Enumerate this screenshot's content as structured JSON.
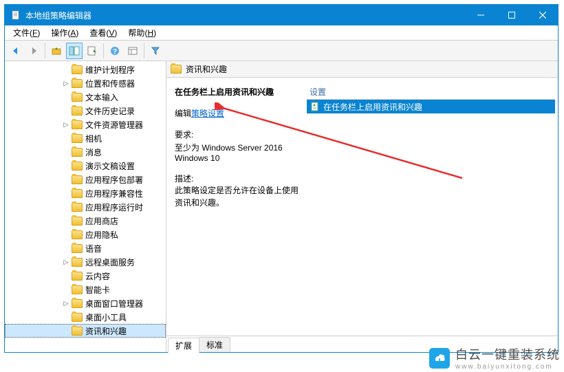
{
  "window": {
    "title": "本地组策略编辑器"
  },
  "menubar": [
    {
      "label": "文件",
      "hotkey": "F"
    },
    {
      "label": "操作",
      "hotkey": "A"
    },
    {
      "label": "查看",
      "hotkey": "V"
    },
    {
      "label": "帮助",
      "hotkey": "H"
    }
  ],
  "tree": {
    "items": [
      {
        "label": "维护计划程序",
        "expandable": false,
        "level": 1
      },
      {
        "label": "位置和传感器",
        "expandable": true,
        "level": 1
      },
      {
        "label": "文本输入",
        "expandable": false,
        "level": 1
      },
      {
        "label": "文件历史记录",
        "expandable": false,
        "level": 1
      },
      {
        "label": "文件资源管理器",
        "expandable": true,
        "level": 1
      },
      {
        "label": "相机",
        "expandable": false,
        "level": 1
      },
      {
        "label": "消息",
        "expandable": false,
        "level": 1
      },
      {
        "label": "演示文稿设置",
        "expandable": false,
        "level": 1
      },
      {
        "label": "应用程序包部署",
        "expandable": false,
        "level": 1
      },
      {
        "label": "应用程序兼容性",
        "expandable": false,
        "level": 1
      },
      {
        "label": "应用程序运行时",
        "expandable": false,
        "level": 1
      },
      {
        "label": "应用商店",
        "expandable": false,
        "level": 1
      },
      {
        "label": "应用隐私",
        "expandable": false,
        "level": 1
      },
      {
        "label": "语音",
        "expandable": false,
        "level": 1
      },
      {
        "label": "远程桌面服务",
        "expandable": true,
        "level": 1
      },
      {
        "label": "云内容",
        "expandable": false,
        "level": 1
      },
      {
        "label": "智能卡",
        "expandable": false,
        "level": 1
      },
      {
        "label": "桌面窗口管理器",
        "expandable": true,
        "level": 1
      },
      {
        "label": "桌面小工具",
        "expandable": false,
        "level": 1
      },
      {
        "label": "资讯和兴趣",
        "expandable": false,
        "level": 1,
        "selected": true
      }
    ]
  },
  "right": {
    "header": "资讯和兴趣",
    "detail": {
      "title": "在任务栏上启用资讯和兴趣",
      "edit_prefix": "编辑",
      "edit_link": "策略设置",
      "req_label": "要求:",
      "req_text": "至少为 Windows Server 2016 Windows 10",
      "desc_label": "描述:",
      "desc_text": "此策略设定是否允许在设备上使用资讯和兴趣。"
    },
    "settings": {
      "header": "设置",
      "rows": [
        {
          "label": "在任务栏上启用资讯和兴趣",
          "selected": true
        }
      ]
    },
    "tabs": [
      {
        "label": "扩展",
        "active": true
      },
      {
        "label": "标准",
        "active": false
      }
    ]
  },
  "watermark": {
    "brand": "白云一键重装系统",
    "sub": "www.baiyunxitong.com"
  }
}
